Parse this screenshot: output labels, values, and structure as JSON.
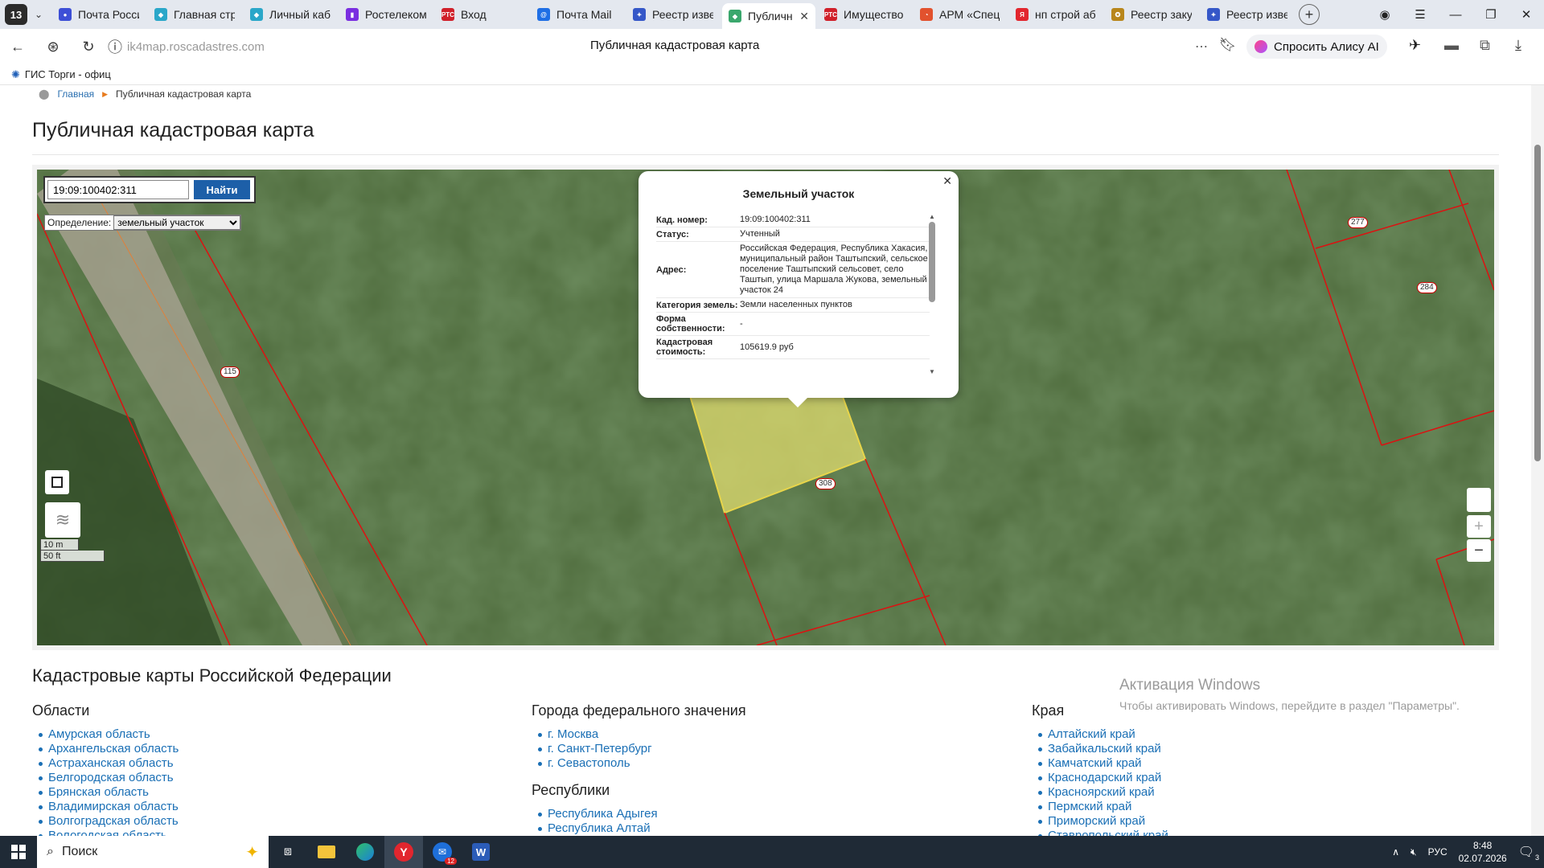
{
  "browser": {
    "tab_count": "13",
    "tabs": [
      {
        "title": "Почта Росси",
        "color": "#3d4fd6",
        "glyph": "●"
      },
      {
        "title": "Главная стр",
        "color": "#2aa7c9",
        "glyph": "◆"
      },
      {
        "title": "Личный каб",
        "color": "#2aa7c9",
        "glyph": "◆"
      },
      {
        "title": "Ростелеком",
        "color": "#7a2ee0",
        "glyph": "▮"
      },
      {
        "title": "Вход",
        "color": "#d0202a",
        "glyph": "РТС"
      },
      {
        "title": "Почта Mail",
        "color": "#1f6fe5",
        "glyph": "@"
      },
      {
        "title": "Реестр изве",
        "color": "#3557c8",
        "glyph": "✦"
      },
      {
        "title": "Публичн",
        "color": "#3aa76d",
        "glyph": "◆"
      },
      {
        "title": "Имущество",
        "color": "#d0202a",
        "glyph": "РТС"
      },
      {
        "title": "АРМ «Спец",
        "color": "#e2522e",
        "glyph": "◔"
      },
      {
        "title": "нп строй аб",
        "color": "#e2262e",
        "glyph": "Я"
      },
      {
        "title": "Реестр заку",
        "color": "#b8861b",
        "glyph": "✪"
      },
      {
        "title": "Реестр изве",
        "color": "#3557c8",
        "glyph": "✦"
      }
    ],
    "active_tab_index": 7,
    "url": "ik4map.roscadastres.com",
    "page_title": "Публичная кадастровая карта",
    "alisa_label": "Спросить Алису AI",
    "bookmark": "ГИС Торги - офиц"
  },
  "breadcrumb": {
    "home": "Главная",
    "current": "Публичная кадастровая карта"
  },
  "page_heading": "Публичная кадастровая карта",
  "map": {
    "search_value": "19:09:100402:311",
    "search_button": "Найти",
    "definition_label": "Определение:",
    "definition_value": "земельный участок",
    "scale_metric": "10 m",
    "scale_imperial": "50 ft",
    "plot_labels": [
      "115",
      "308",
      "277",
      "284"
    ],
    "zoom_in": "+",
    "zoom_out": "−"
  },
  "popup": {
    "title": "Земельный участок",
    "rows": [
      {
        "k": "Кад. номер:",
        "v": "19:09:100402:311"
      },
      {
        "k": "Статус:",
        "v": "Учтенный"
      },
      {
        "k": "Адрес:",
        "v": "Российская Федерация, Республика Хакасия, муниципальный район Таштыпский, сельское поселение Таштыпский сельсовет, село Таштып, улица Маршала Жукова, земельный участок 24"
      },
      {
        "k": "Категория земель:",
        "v": "Земли населенных пунктов"
      },
      {
        "k": "Форма собственности:",
        "v": "-"
      },
      {
        "k": "Кадастровая стоимость:",
        "v": "105619.9 руб"
      }
    ]
  },
  "section_heading": "Кадастровые карты Российской Федерации",
  "columns": {
    "oblasti": {
      "title": "Области",
      "items": [
        "Амурская область",
        "Архангельская область",
        "Астраханская область",
        "Белгородская область",
        "Брянская область",
        "Владимирская область",
        "Волгоградская область",
        "Вологодская область"
      ]
    },
    "cities": {
      "title": "Города федерального значения",
      "items": [
        "г. Москва",
        "г. Санкт-Петербург",
        "г. Севастополь"
      ]
    },
    "republics": {
      "title": "Республики",
      "items": [
        "Республика Адыгея",
        "Республика Алтай"
      ]
    },
    "krai": {
      "title": "Края",
      "items": [
        "Алтайский край",
        "Забайкальский край",
        "Камчатский край",
        "Краснодарский край",
        "Красноярский край",
        "Пермский край",
        "Приморский край",
        "Ставропольский край"
      ]
    }
  },
  "watermark": {
    "line1": "Активация Windows",
    "line2": "Чтобы активировать Windows, перейдите в раздел \"Параметры\"."
  },
  "taskbar": {
    "search_placeholder": "Поиск",
    "lang": "РУС",
    "time": "8:48",
    "date": "02.07.2026",
    "notif": "3",
    "mail_badge": "12"
  }
}
